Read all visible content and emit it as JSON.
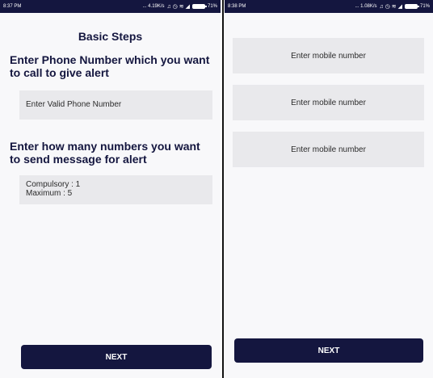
{
  "left_screen": {
    "status_bar": {
      "time": "8:37 PM",
      "speed": "... 4.19K/s",
      "icons": "♫ ◷ ≋ ◢",
      "battery": "71%"
    },
    "title": "Basic Steps",
    "phone_heading": "Enter Phone Number which you want to call to give alert",
    "phone_placeholder": "Enter Valid Phone Number",
    "count_heading": "Enter how many numbers you want to send message for alert",
    "count_info": {
      "compulsory": "Compulsory : 1",
      "maximum": "Maximum : 5"
    },
    "next_label": "NEXT"
  },
  "right_screen": {
    "status_bar": {
      "time": "8:38 PM",
      "speed": "... 1.08K/s",
      "icons": "♫ ◷ ≋ ◢",
      "battery": "71%"
    },
    "mobile_fields": [
      "Enter mobile number",
      "Enter mobile number",
      "Enter mobile number"
    ],
    "next_label": "NEXT"
  },
  "colors": {
    "primary_dark": "#14163f",
    "field_bg": "#e9e9ec",
    "screen_bg": "#f8f8fa"
  },
  "icons": [
    "alarm-icon",
    "wifi-icon",
    "signal-icon",
    "battery-icon"
  ]
}
